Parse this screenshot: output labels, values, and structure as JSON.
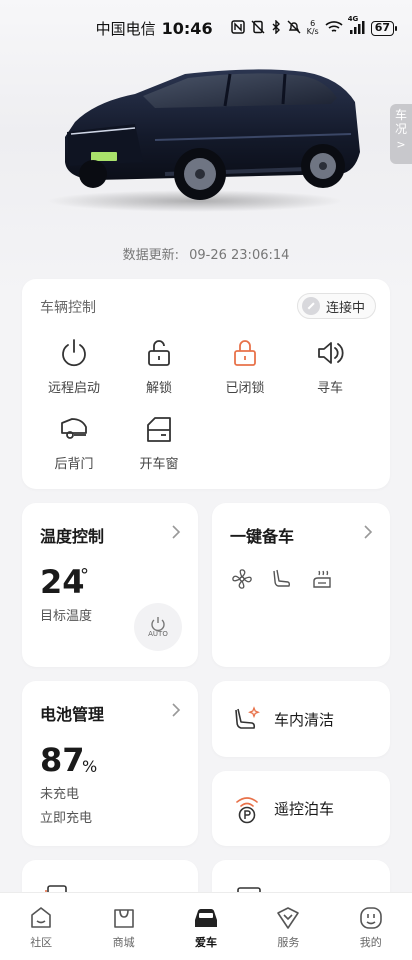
{
  "status_bar": {
    "carrier": "中国电信",
    "time": "10:46",
    "network_speed_top": "6",
    "network_speed_unit": "K/s",
    "signal_label": "4G",
    "battery": "67"
  },
  "side_tab": {
    "label_line1": "车",
    "label_line2": "况",
    "chevron": ">"
  },
  "update": {
    "label": "数据更新:",
    "value": "09-26 23:06:14"
  },
  "vehicle_control": {
    "title": "车辆控制",
    "connect_label": "连接中",
    "controls": [
      {
        "label": "远程启动",
        "icon": "power-icon"
      },
      {
        "label": "解锁",
        "icon": "unlock-icon"
      },
      {
        "label": "已闭锁",
        "icon": "lock-icon",
        "color": "#e8724a"
      },
      {
        "label": "寻车",
        "icon": "speaker-icon"
      },
      {
        "label": "后背门",
        "icon": "tailgate-icon"
      },
      {
        "label": "开车窗",
        "icon": "window-icon"
      }
    ]
  },
  "temperature": {
    "title": "温度控制",
    "value": "24",
    "unit": "°",
    "label": "目标温度",
    "auto_label": "AUTO"
  },
  "one_key": {
    "title": "一键备车",
    "icons": [
      "fan-icon",
      "seat-icon",
      "seat-heat-icon"
    ]
  },
  "battery": {
    "title": "电池管理",
    "value": "87",
    "unit": "%",
    "status": "未充电",
    "action": "立即充电"
  },
  "clean": {
    "label": "车内清洁"
  },
  "parking": {
    "label": "遥控泊车"
  },
  "nav": {
    "items": [
      {
        "label": "社区",
        "icon": "community-icon"
      },
      {
        "label": "商城",
        "icon": "shop-icon"
      },
      {
        "label": "爱车",
        "icon": "car-icon",
        "active": true
      },
      {
        "label": "服务",
        "icon": "service-icon"
      },
      {
        "label": "我的",
        "icon": "profile-icon"
      }
    ]
  },
  "colors": {
    "accent": "#e8724a",
    "background": "#f4f4f6",
    "card": "#ffffff"
  }
}
